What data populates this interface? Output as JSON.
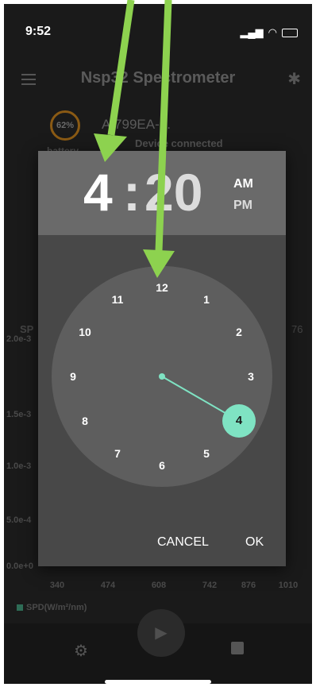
{
  "status_bar": {
    "time": "9:52"
  },
  "app": {
    "title": "Nsp32 Spectrometer",
    "battery_percent": "62%",
    "battery_label": "battery",
    "device_name": "AI799EA-...",
    "device_status": "Device connected",
    "tab_left": "SP",
    "tab_right": "76"
  },
  "chart_background": {
    "y_ticks": [
      "2.0e-3",
      "1.5e-3",
      "1.0e-3",
      "5.0e-4",
      "0.0e+0"
    ],
    "x_ticks": [
      "340",
      "474",
      "608",
      "742",
      "876",
      "1010"
    ],
    "legend": "SPD(W/m²/nm)"
  },
  "time_picker": {
    "hour": "4",
    "colon": ":",
    "minute": "20",
    "am_label": "AM",
    "pm_label": "PM",
    "selected_period": "AM",
    "clock_numbers": [
      "12",
      "1",
      "2",
      "3",
      "4",
      "5",
      "6",
      "7",
      "8",
      "9",
      "10",
      "11"
    ],
    "selected_hour": 4,
    "cancel_label": "CANCEL",
    "ok_label": "OK"
  },
  "colors": {
    "accent": "#7fe3c3",
    "annotation_arrow": "#8dd24f",
    "dialog": "#484848",
    "dialog_header": "#6a6a6a"
  }
}
